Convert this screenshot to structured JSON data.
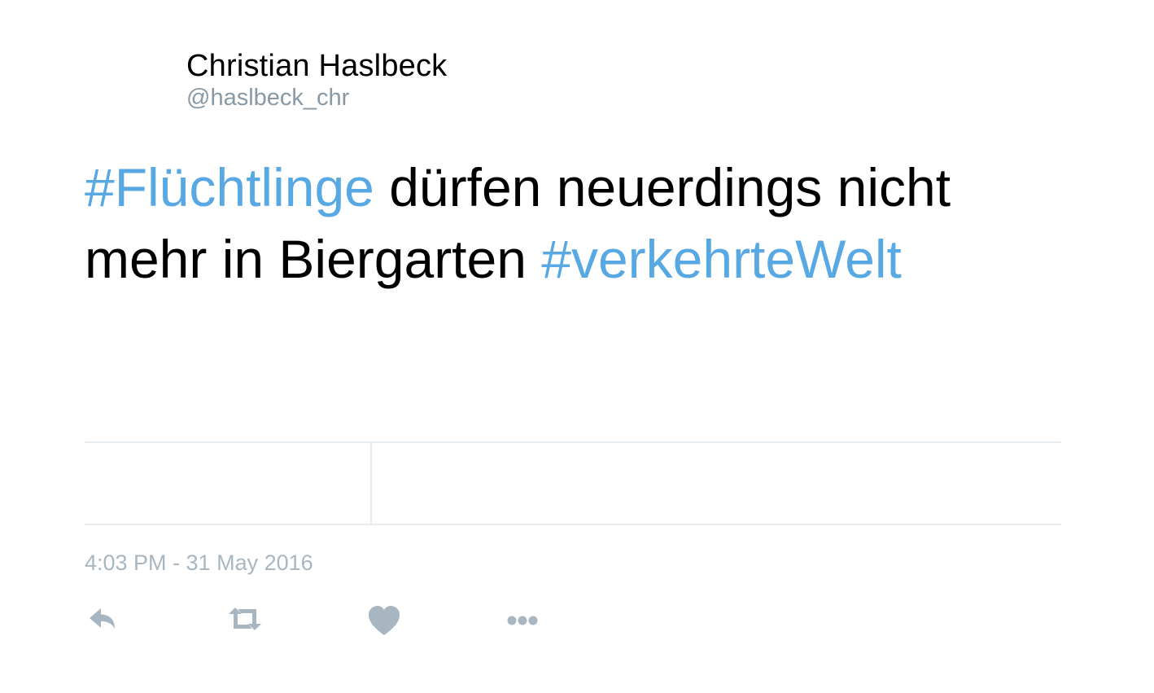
{
  "author": {
    "name": "Christian Haslbeck",
    "handle": "@haslbeck_chr"
  },
  "tweet": {
    "segments": [
      {
        "text": "#Flüchtlinge",
        "type": "hashtag"
      },
      {
        "text": " dürfen neuerdings nicht mehr in Biergarten ",
        "type": "text"
      },
      {
        "text": "#verkehrteWelt",
        "type": "hashtag"
      }
    ],
    "timestamp": "4:03 PM - 31 May 2016"
  },
  "actions": [
    {
      "name": "reply",
      "icon": "reply-icon"
    },
    {
      "name": "retweet",
      "icon": "retweet-icon"
    },
    {
      "name": "like",
      "icon": "heart-icon"
    },
    {
      "name": "more",
      "icon": "more-dots-icon"
    }
  ],
  "colors": {
    "hashtag": "#58a8e3",
    "text": "#000000",
    "muted": "#8899a6",
    "icon": "#a8b6c1",
    "divider": "#e6ecf0"
  }
}
